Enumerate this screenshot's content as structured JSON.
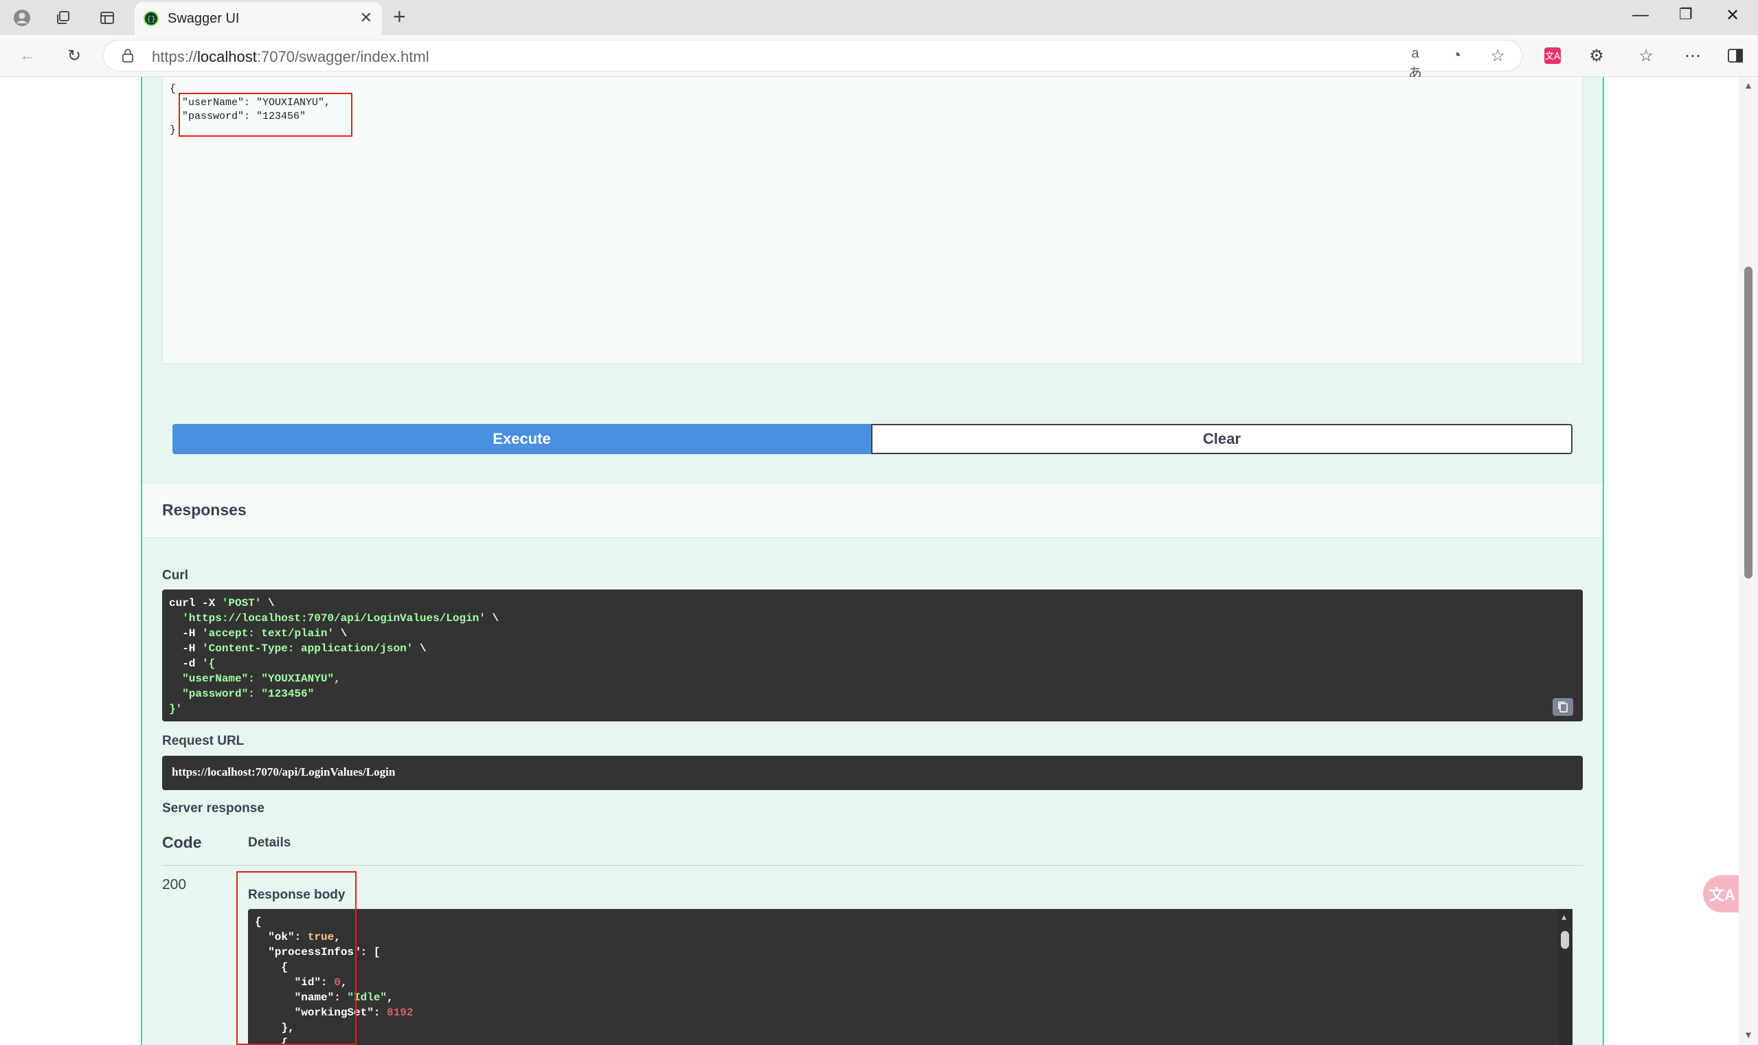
{
  "browser": {
    "tab_title": "Swagger UI",
    "url_scheme": "https://",
    "url_host": "localhost",
    "url_rest": ":7070/swagger/index.html"
  },
  "request_body": {
    "text": "{\n  \"userName\": \"YOUXIANYU\",\n  \"password\": \"123456\"\n}"
  },
  "buttons": {
    "execute": "Execute",
    "clear": "Clear"
  },
  "responses": {
    "title": "Responses",
    "curl_label": "Curl",
    "curl_lines": [
      "curl -X ",
      "'POST'",
      " \\",
      "'https://localhost:7070/api/LoginValues/Login'",
      "'accept: text/plain'",
      "'Content-Type: application/json'",
      "'{",
      "\"userName\": \"YOUXIANYU\",",
      "\"password\": \"123456\"",
      "}'"
    ],
    "request_url_label": "Request URL",
    "request_url": "https://localhost:7070/api/LoginValues/Login",
    "server_response_label": "Server response",
    "code_header": "Code",
    "details_header": "Details",
    "code": "200",
    "response_body_label": "Response body",
    "response_body": {
      "ok_key": "\"ok\"",
      "ok_val": "true",
      "processInfos_key": "\"processInfos\"",
      "id_key": "\"id\"",
      "id_val": "0",
      "name_key": "\"name\"",
      "name_val": "\"Idle\"",
      "workingSet_key": "\"workingSet\"",
      "workingSet_val": "8192"
    }
  },
  "colors": {
    "execute_bg": "#4990e2",
    "opblock_bg": "#e8f6f0",
    "opblock_border": "#49cc90",
    "code_bg": "#333333",
    "highlight": "#e02020"
  }
}
